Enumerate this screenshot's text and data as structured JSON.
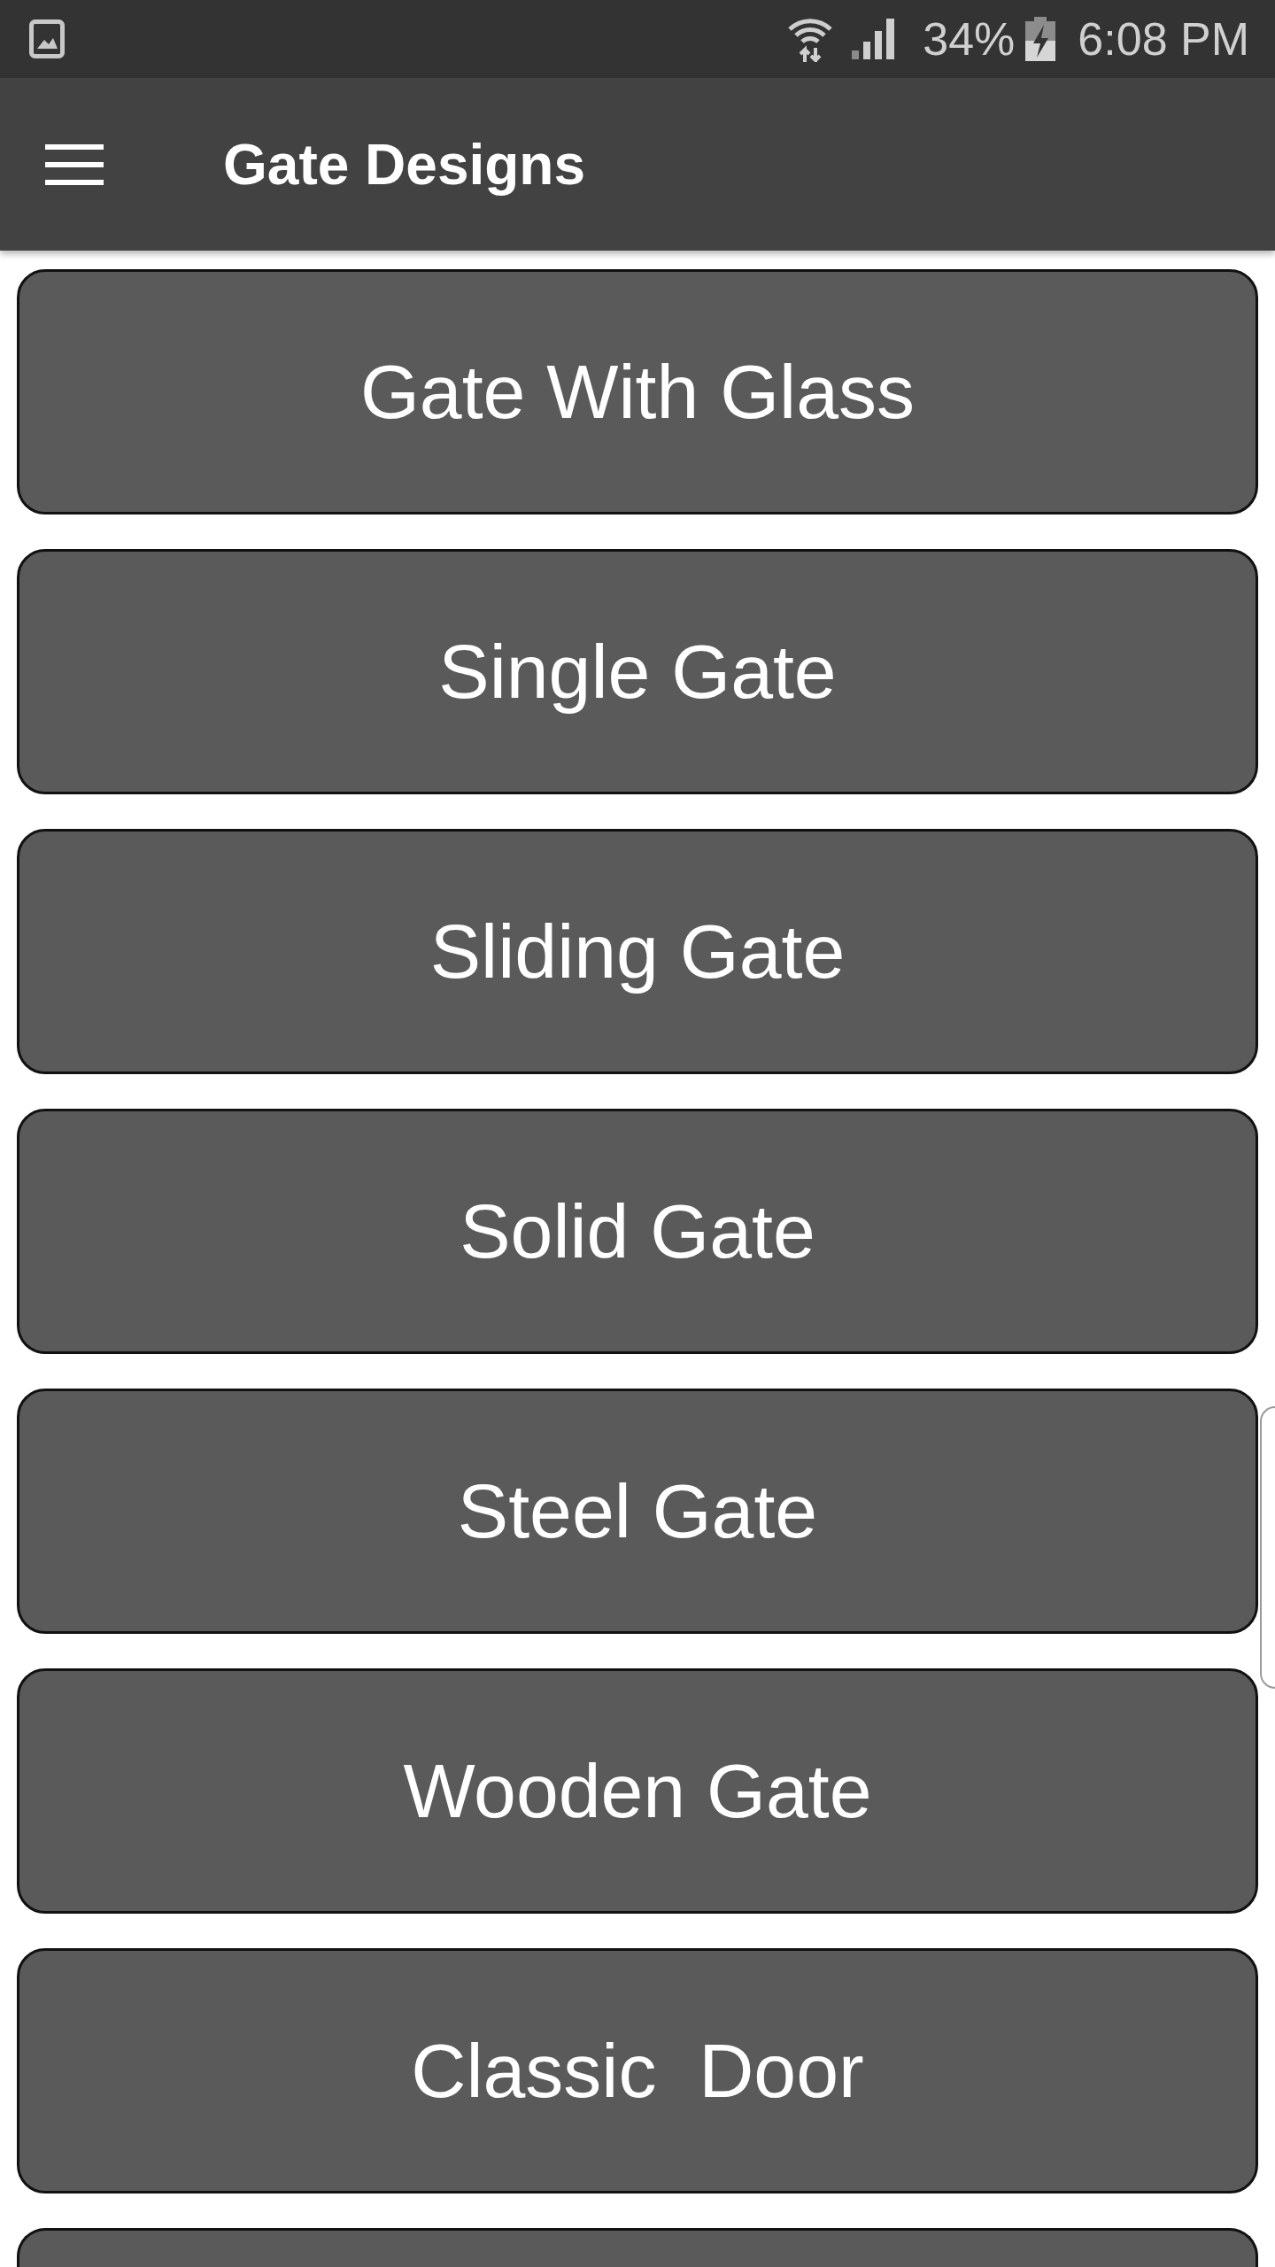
{
  "status_bar": {
    "battery": "34%",
    "time": "6:08 PM"
  },
  "app_bar": {
    "title": "Gate Designs"
  },
  "gate_buttons": [
    {
      "label": "Gate With Glass"
    },
    {
      "label": "Single Gate"
    },
    {
      "label": "Sliding Gate"
    },
    {
      "label": "Solid Gate"
    },
    {
      "label": "Steel Gate"
    },
    {
      "label": "Wooden Gate"
    },
    {
      "label": "Classic  Door"
    }
  ]
}
